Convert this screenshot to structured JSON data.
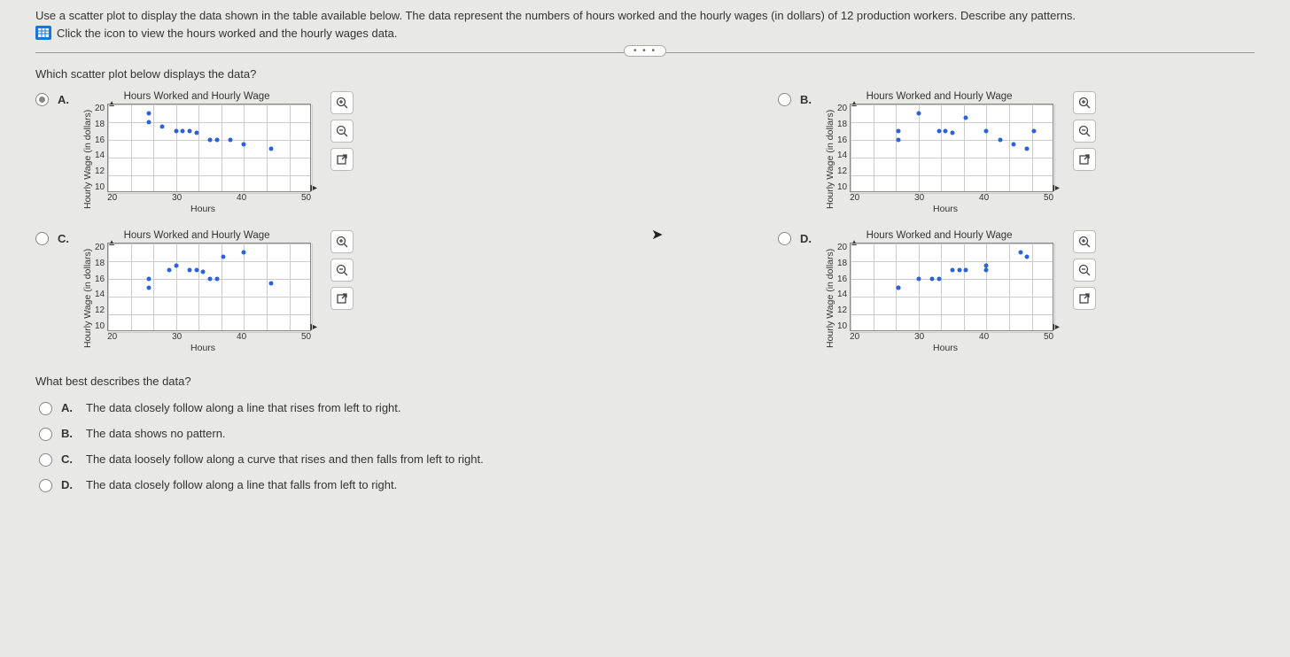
{
  "question": {
    "prompt": "Use a scatter plot to display the data shown in the table available below. The data represent the numbers of hours worked and the hourly wages (in dollars) of 12 production workers. Describe any patterns.",
    "data_link": "Click the icon to view the hours worked and the hourly wages data."
  },
  "q1": {
    "prompt": "Which scatter plot below displays the data?",
    "options": {
      "A": "A.",
      "B": "B.",
      "C": "C.",
      "D": "D."
    }
  },
  "charts": {
    "title": "Hours Worked and Hourly Wage",
    "xlabel": "Hours",
    "ylabel": "Hourly Wage (in dollars)",
    "xticks": [
      "20",
      "30",
      "40",
      "50"
    ],
    "yticks": [
      "20",
      "18",
      "16",
      "14",
      "12",
      "10"
    ]
  },
  "chart_data": [
    {
      "id": "A",
      "type": "scatter",
      "title": "Hours Worked and Hourly Wage",
      "xlabel": "Hours",
      "ylabel": "Hourly Wage (in dollars)",
      "xlim": [
        20,
        50
      ],
      "ylim": [
        10,
        20
      ],
      "points": [
        [
          26,
          19
        ],
        [
          26,
          18
        ],
        [
          28,
          17.5
        ],
        [
          30,
          17
        ],
        [
          31,
          17
        ],
        [
          32,
          17
        ],
        [
          33,
          16.8
        ],
        [
          35,
          16
        ],
        [
          36,
          16
        ],
        [
          38,
          16
        ],
        [
          40,
          15.5
        ],
        [
          44,
          15
        ]
      ]
    },
    {
      "id": "B",
      "type": "scatter",
      "title": "Hours Worked and Hourly Wage",
      "xlabel": "Hours",
      "ylabel": "Hourly Wage (in dollars)",
      "xlim": [
        20,
        50
      ],
      "ylim": [
        10,
        20
      ],
      "points": [
        [
          27,
          16
        ],
        [
          27,
          17
        ],
        [
          30,
          19
        ],
        [
          33,
          17
        ],
        [
          34,
          17
        ],
        [
          35,
          16.8
        ],
        [
          37,
          18.5
        ],
        [
          40,
          17
        ],
        [
          42,
          16
        ],
        [
          44,
          15.5
        ],
        [
          46,
          15
        ],
        [
          47,
          17
        ]
      ]
    },
    {
      "id": "C",
      "type": "scatter",
      "title": "Hours Worked and Hourly Wage",
      "xlabel": "Hours",
      "ylabel": "Hourly Wage (in dollars)",
      "xlim": [
        20,
        50
      ],
      "ylim": [
        10,
        20
      ],
      "points": [
        [
          26,
          15
        ],
        [
          26,
          16
        ],
        [
          29,
          17
        ],
        [
          30,
          17.5
        ],
        [
          32,
          17
        ],
        [
          33,
          17
        ],
        [
          34,
          16.8
        ],
        [
          35,
          16
        ],
        [
          36,
          16
        ],
        [
          37,
          18.5
        ],
        [
          40,
          19
        ],
        [
          44,
          15.5
        ]
      ]
    },
    {
      "id": "D",
      "type": "scatter",
      "title": "Hours Worked and Hourly Wage",
      "xlabel": "Hours",
      "ylabel": "Hourly Wage (in dollars)",
      "xlim": [
        20,
        50
      ],
      "ylim": [
        10,
        20
      ],
      "points": [
        [
          27,
          15
        ],
        [
          27,
          15
        ],
        [
          30,
          16
        ],
        [
          32,
          16
        ],
        [
          33,
          16
        ],
        [
          35,
          17
        ],
        [
          36,
          17
        ],
        [
          37,
          17
        ],
        [
          40,
          17.5
        ],
        [
          40,
          17
        ],
        [
          45,
          19
        ],
        [
          46,
          18.5
        ]
      ]
    }
  ],
  "q2": {
    "prompt": "What best describes the data?",
    "options": {
      "A": {
        "label": "A.",
        "text": "The data closely follow along a line that rises from left to right."
      },
      "B": {
        "label": "B.",
        "text": "The data shows no pattern."
      },
      "C": {
        "label": "C.",
        "text": "The data loosely follow along a curve that rises and then falls from left to right."
      },
      "D": {
        "label": "D.",
        "text": "The data closely follow along a line that falls from left to right."
      }
    }
  },
  "expand": "• • •"
}
